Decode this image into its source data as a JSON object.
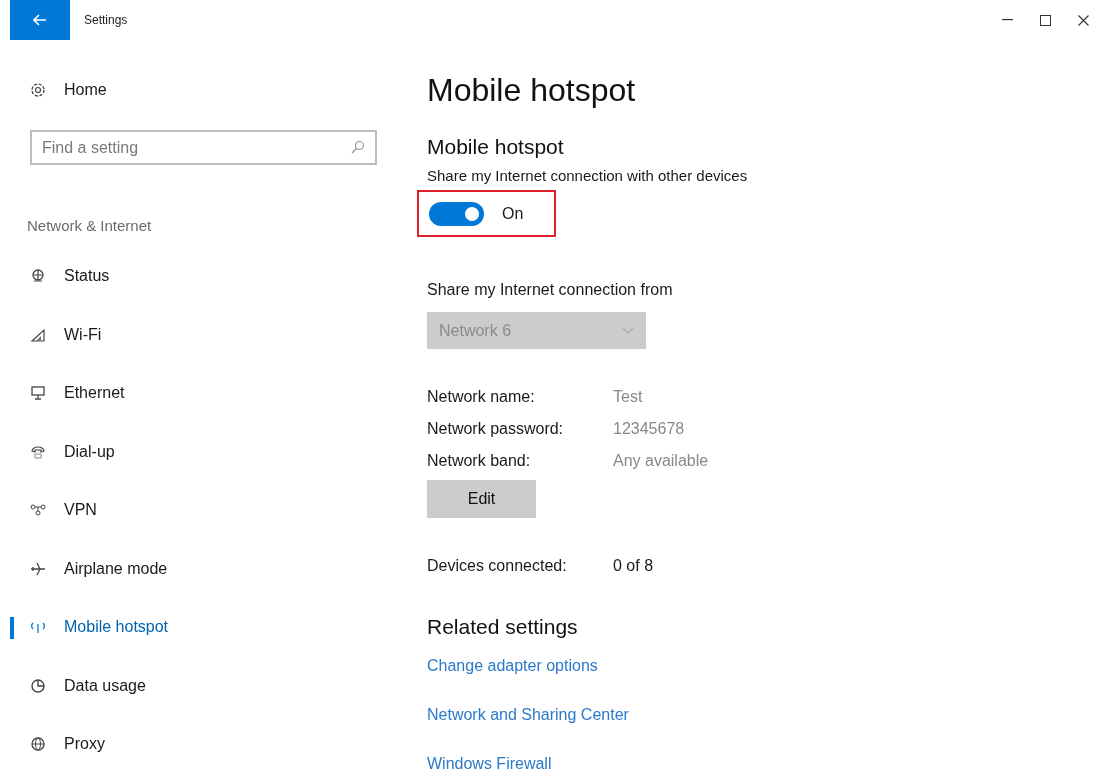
{
  "window": {
    "title": "Settings"
  },
  "sidebar": {
    "home": "Home",
    "search": {
      "placeholder": "Find a setting"
    },
    "section": "Network & Internet",
    "items": [
      {
        "label": "Status",
        "selected": false
      },
      {
        "label": "Wi-Fi",
        "selected": false
      },
      {
        "label": "Ethernet",
        "selected": false
      },
      {
        "label": "Dial-up",
        "selected": false
      },
      {
        "label": "VPN",
        "selected": false
      },
      {
        "label": "Airplane mode",
        "selected": false
      },
      {
        "label": "Mobile hotspot",
        "selected": true
      },
      {
        "label": "Data usage",
        "selected": false
      },
      {
        "label": "Proxy",
        "selected": false
      }
    ]
  },
  "page": {
    "title": "Mobile hotspot",
    "heading": "Mobile hotspot",
    "description": "Share my Internet connection with other devices",
    "toggle": {
      "on": true,
      "label": "On",
      "highlighted": true
    },
    "share_from": {
      "label": "Share my Internet connection from",
      "value": "Network 6",
      "disabled": true
    },
    "details": [
      {
        "label": "Network name:",
        "value": "Test"
      },
      {
        "label": "Network password:",
        "value": "12345678"
      },
      {
        "label": "Network band:",
        "value": "Any available"
      }
    ],
    "edit_button": "Edit",
    "devices": {
      "label": "Devices connected:",
      "value": "0 of 8"
    },
    "related": {
      "title": "Related settings",
      "links": [
        "Change adapter options",
        "Network and Sharing Center",
        "Windows Firewall"
      ]
    }
  }
}
